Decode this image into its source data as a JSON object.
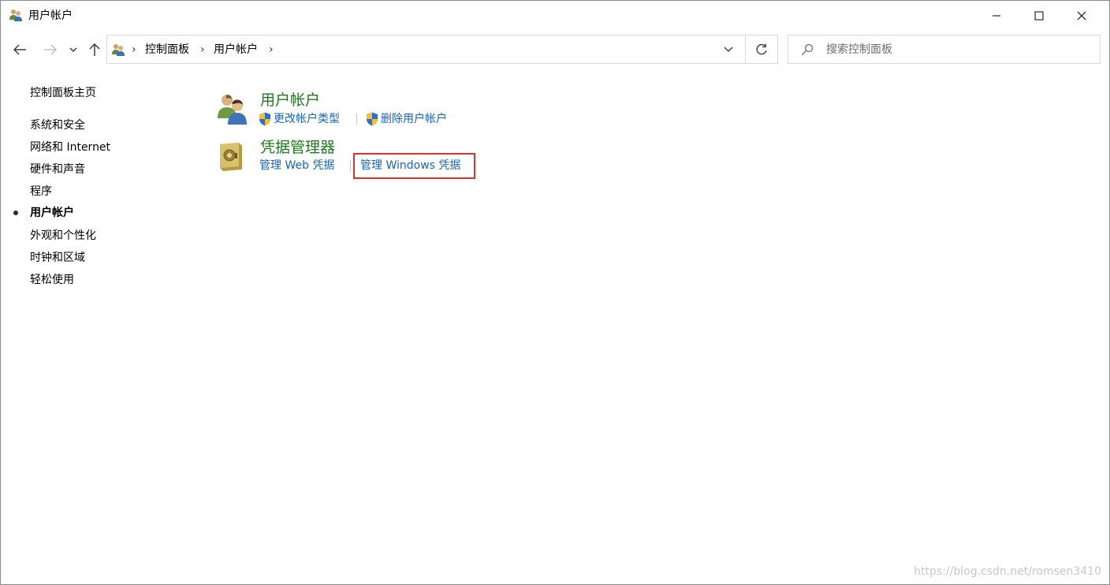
{
  "window": {
    "title": "用户帐户",
    "minimize_glyph": "—",
    "maximize_glyph": "☐",
    "close_glyph": "✕"
  },
  "nav": {
    "back_icon": "back-arrow-icon",
    "forward_icon": "forward-arrow-icon",
    "recent_icon": "chevron-down-icon",
    "up_icon": "up-arrow-icon"
  },
  "address": {
    "breadcrumbs": [
      {
        "label": "控制面板"
      },
      {
        "label": "用户帐户"
      }
    ],
    "separator": "›"
  },
  "search": {
    "placeholder": "搜索控制面板",
    "value": ""
  },
  "sidebar": {
    "home": "控制面板主页",
    "items": [
      {
        "label": "系统和安全",
        "active": false
      },
      {
        "label": "网络和 Internet",
        "active": false
      },
      {
        "label": "硬件和声音",
        "active": false
      },
      {
        "label": "程序",
        "active": false
      },
      {
        "label": "用户帐户",
        "active": true
      },
      {
        "label": "外观和个性化",
        "active": false
      },
      {
        "label": "时钟和区域",
        "active": false
      },
      {
        "label": "轻松使用",
        "active": false
      }
    ]
  },
  "categories": [
    {
      "title": "用户帐户",
      "icon": "users-icon",
      "tasks": [
        {
          "label": "更改帐户类型",
          "shield": true
        },
        {
          "label": "删除用户帐户",
          "shield": true
        }
      ]
    },
    {
      "title": "凭据管理器",
      "icon": "credential-vault-icon",
      "tasks": [
        {
          "label": "管理 Web 凭据",
          "shield": false
        },
        {
          "label": "管理 Windows 凭据",
          "shield": false,
          "highlighted": true
        }
      ]
    }
  ],
  "colors": {
    "category_title": "#1e7b1e",
    "link": "#1565c0",
    "highlight_border": "#e0312f"
  },
  "watermark": "https://blog.csdn.net/romsen3410"
}
